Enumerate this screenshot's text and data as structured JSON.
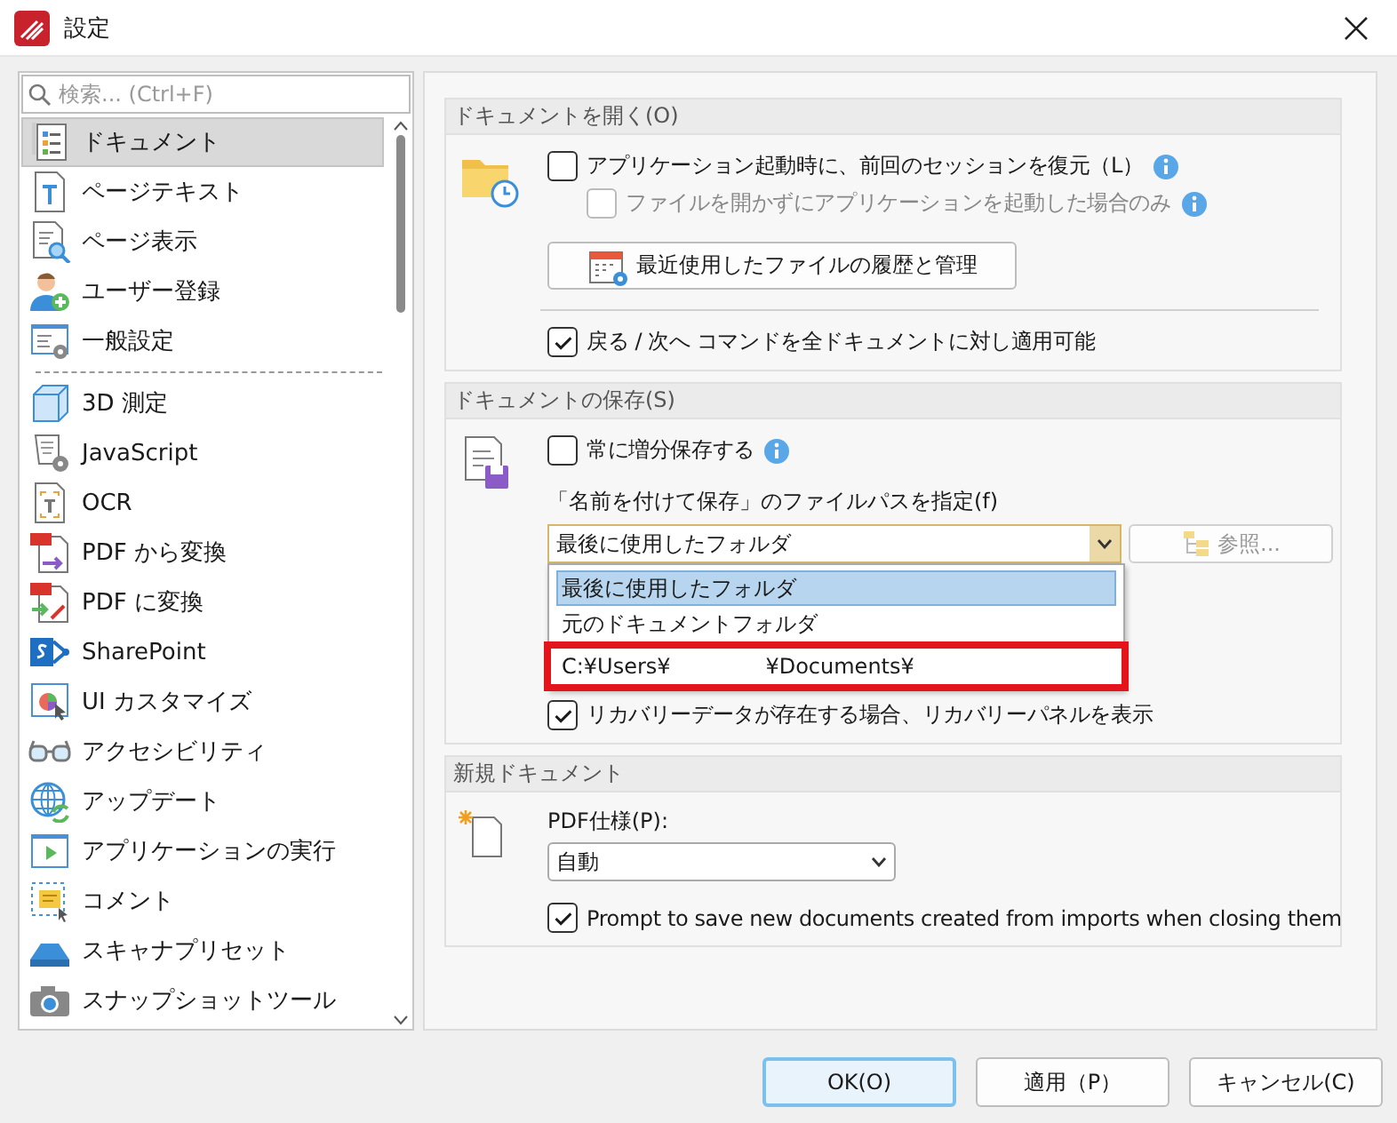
{
  "window": {
    "title": "設定"
  },
  "sidebar": {
    "search": {
      "placeholder": "検索... (Ctrl+F)"
    },
    "groups": [
      {
        "items": [
          {
            "label": "ドキュメント",
            "selected": true
          },
          {
            "label": "ページテキスト",
            "selected": false
          },
          {
            "label": "ページ表示",
            "selected": false
          },
          {
            "label": "ユーザー登録",
            "selected": false
          },
          {
            "label": "一般設定",
            "selected": false
          }
        ]
      },
      {
        "items": [
          {
            "label": "3D 測定",
            "selected": false
          },
          {
            "label": "JavaScript",
            "selected": false
          },
          {
            "label": "OCR",
            "selected": false
          },
          {
            "label": "PDF から変換",
            "selected": false
          },
          {
            "label": "PDF に変換",
            "selected": false
          },
          {
            "label": "SharePoint",
            "selected": false
          },
          {
            "label": "UI カスタマイズ",
            "selected": false
          },
          {
            "label": "アクセシビリティ",
            "selected": false
          },
          {
            "label": "アップデート",
            "selected": false
          },
          {
            "label": "アプリケーションの実行",
            "selected": false
          },
          {
            "label": "コメント",
            "selected": false
          },
          {
            "label": "スキャナプリセット",
            "selected": false
          },
          {
            "label": "スナップショットツール",
            "selected": false
          }
        ]
      }
    ]
  },
  "open_documents": {
    "title": "ドキュメントを開く(O)",
    "restore_session": {
      "label": "アプリケーション起動時に、前回のセッションを復元（L）",
      "checked": false,
      "disabled": false,
      "info": true
    },
    "only_without_file": {
      "label": "ファイルを開かずにアプリケーションを起動した場合のみ",
      "checked": false,
      "disabled": true,
      "info": true
    },
    "history_button": "最近使用したファイルの履歴と管理",
    "undo_redo": {
      "label": "戻る / 次へ コマンドを全ドキュメントに対し適用可能",
      "checked": true,
      "disabled": false,
      "info": false
    }
  },
  "save_documents": {
    "title": "ドキュメントの保存(S)",
    "incremental": {
      "label": "常に増分保存する",
      "checked": false,
      "disabled": false,
      "info": true
    },
    "path_label": "「名前を付けて保存」のファイルパスを指定(f)",
    "path_combo": {
      "value": "最後に使用したフォルダ",
      "expanded": true,
      "options": [
        {
          "label": "最後に使用したフォルダ",
          "selected": true,
          "outlined": false
        },
        {
          "label": "元のドキュメントフォルダ",
          "selected": false,
          "outlined": false
        },
        {
          "label": "C:¥Users¥              ¥Documents¥",
          "selected": false,
          "outlined": true
        }
      ]
    },
    "browse_button": {
      "label": "参照...",
      "disabled": true
    },
    "recovery": {
      "label": "リカバリーデータが存在する場合、リカバリーパネルを表示",
      "checked": true,
      "disabled": false,
      "info": false
    }
  },
  "new_document": {
    "title": "新規ドキュメント",
    "pdf_spec_label": "PDF仕様(P):",
    "pdf_spec": {
      "value": "自動"
    },
    "prompt": {
      "label": "Prompt to save new documents created from imports when closing them",
      "checked": true,
      "disabled": false,
      "info": false
    }
  },
  "buttons": [
    {
      "label": "OK(O)",
      "default": true
    },
    {
      "label": "適用（P）",
      "default": false
    },
    {
      "label": "キャンセル(C)",
      "default": false
    }
  ]
}
